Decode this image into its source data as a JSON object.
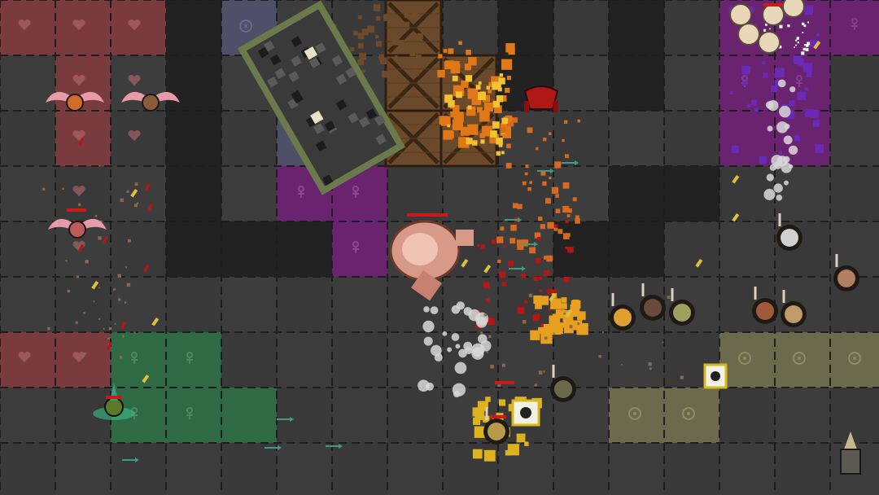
{
  "game": {
    "view": "top-down arena",
    "palette": {
      "floor": "#3d3d3d",
      "floor_alt": "#363636",
      "grid_line": "#1e1e1e",
      "wall": "#222222",
      "zone_red": "#7a3b3e",
      "zone_purple": "#6a236f",
      "zone_green": "#2f6a45",
      "zone_olive": "#6b6a4c",
      "zone_slate": "#4e5068",
      "crate": "#6b4a2c",
      "blood": "#b31616",
      "fire": "#e07818",
      "bullet": "#e2bf3a",
      "arrow_teal": "#3f9a86",
      "smoke": "#d8d8d8",
      "purple_spark": "#6a2ab8"
    },
    "zone_marks": {
      "red_zone": "heart",
      "purple_zone": "ankh",
      "green_zone": "ankh",
      "olive_zone": "target-circle",
      "slate_zone": "target-circle"
    },
    "units": [
      {
        "name": "winged-demon",
        "team": "red"
      },
      {
        "name": "winged-demon",
        "team": "red"
      },
      {
        "name": "winged-demon",
        "team": "red"
      },
      {
        "name": "green-mage",
        "team": "green"
      },
      {
        "name": "giant-flesh-brute",
        "team": "neutral"
      },
      {
        "name": "dark-stone-golem",
        "team": "neutral"
      },
      {
        "name": "red-crab-beast",
        "team": "red"
      },
      {
        "name": "skeleton-squad",
        "team": "white"
      },
      {
        "name": "shield-warrior",
        "team": "yellow"
      },
      {
        "name": "archer-group",
        "team": "tan"
      }
    ]
  }
}
